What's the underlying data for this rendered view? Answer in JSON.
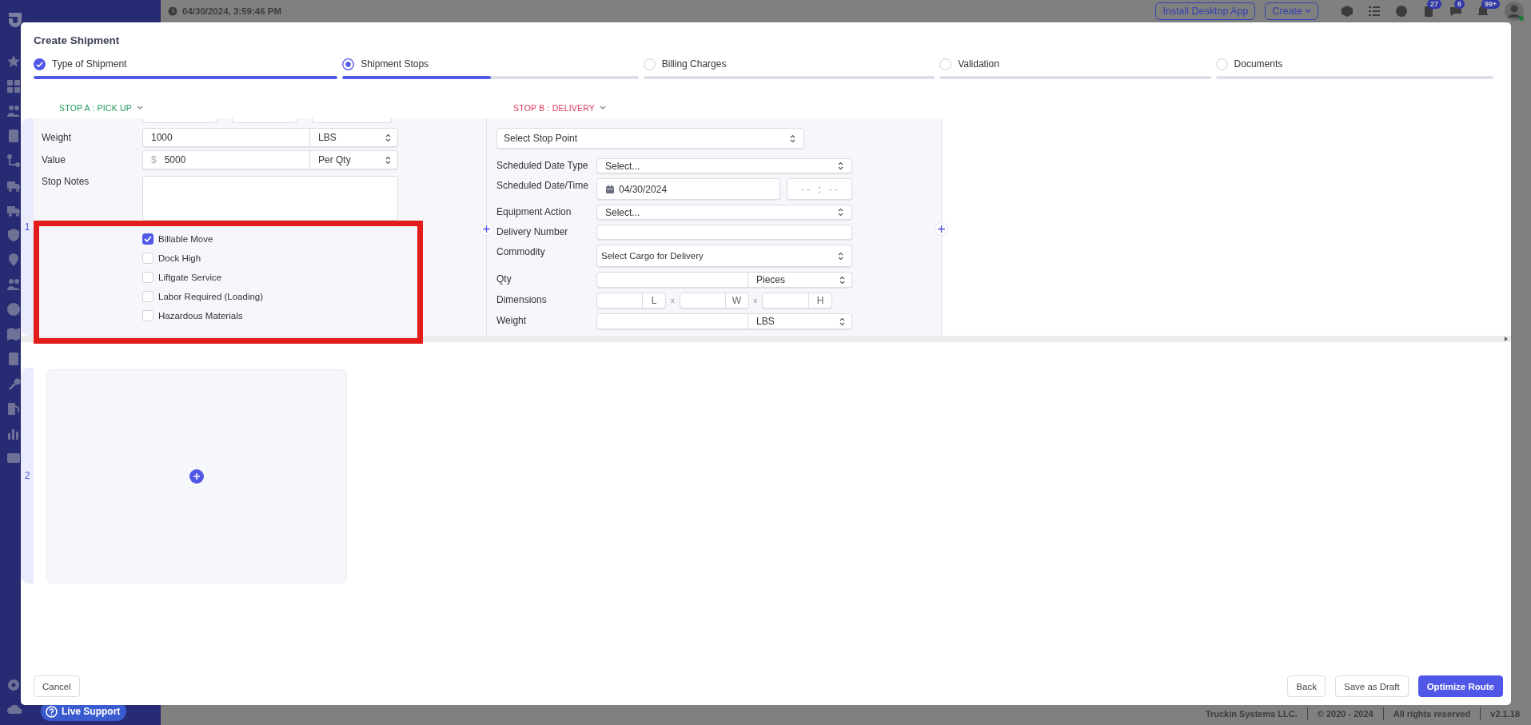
{
  "background": {
    "timestamp": "04/30/2024, 3:59:46 PM",
    "header_buttons": [
      {
        "label": "Install Desktop App",
        "kind": "plain"
      },
      {
        "label": "Create",
        "kind": "dropdown"
      }
    ],
    "notification_badges": [
      "27",
      "6",
      "99+"
    ],
    "footer": [
      "Truckin Systems LLC.",
      "© 2020 - 2024",
      "All rights reserved",
      "v2.1.18"
    ],
    "live_support": "Live Support"
  },
  "modal": {
    "title": "Create Shipment",
    "steps": [
      {
        "label": "Type of Shipment",
        "completed": true,
        "selected": false,
        "level": 1
      },
      {
        "label": "Shipment Stops",
        "completed": false,
        "selected": true,
        "level": 0.5
      },
      {
        "label": "Billing Charges",
        "completed": false,
        "selected": false,
        "level": 0
      },
      {
        "label": "Validation",
        "completed": false,
        "selected": false,
        "level": 0
      },
      {
        "label": "Documents",
        "completed": false,
        "selected": false,
        "level": 0
      }
    ],
    "stop_headers": [
      {
        "label": "STOP A : PICK UP",
        "color": "#1e9a5a"
      },
      {
        "label": "STOP B : DELIVERY",
        "color": "#e0345c"
      }
    ],
    "row_numbers": [
      "1",
      "2"
    ],
    "stop_a": {
      "fields": [
        {
          "label": "Weight",
          "value": "1000",
          "unit": "LBS"
        },
        {
          "label": "Value",
          "prefix": "$",
          "value": "5000",
          "unit": "Per Qty"
        }
      ],
      "notes_label": "Stop Notes",
      "checks": [
        {
          "label": "Billable Move",
          "checked": true
        },
        {
          "label": "Dock High",
          "checked": false
        },
        {
          "label": "Liftgate Service",
          "checked": false
        },
        {
          "label": "Labor Required (Loading)",
          "checked": false
        },
        {
          "label": "Hazardous Materials",
          "checked": false
        }
      ]
    },
    "stop_b": {
      "stop_point": "Select Stop Point",
      "fields": [
        {
          "kind": "select",
          "label": "Scheduled Date Type",
          "value": "Select..."
        },
        {
          "kind": "datetime",
          "label": "Scheduled Date/Time",
          "date": "04/30/2024",
          "hour": "- -",
          "colon": ":",
          "minute": "- -"
        },
        {
          "kind": "select",
          "label": "Equipment Action",
          "value": "Select..."
        },
        {
          "kind": "input",
          "label": "Delivery Number"
        },
        {
          "kind": "cargo",
          "label": "Commodity",
          "value": "Select Cargo for Delivery"
        },
        {
          "kind": "unit",
          "label": "Qty",
          "unit": "Pieces"
        },
        {
          "kind": "dims",
          "label": "Dimensions",
          "units": [
            "L",
            "W",
            "H"
          ],
          "separators": [
            "x",
            "x"
          ]
        },
        {
          "kind": "unit",
          "label": "Weight",
          "unit": "LBS"
        }
      ]
    },
    "left_actions": [
      {
        "label": "Cancel"
      }
    ],
    "right_actions": [
      {
        "label": "Back",
        "kind": "plain"
      },
      {
        "label": "Save as Draft",
        "kind": "plain"
      },
      {
        "label": "Optimize Route",
        "kind": "primary"
      }
    ]
  }
}
